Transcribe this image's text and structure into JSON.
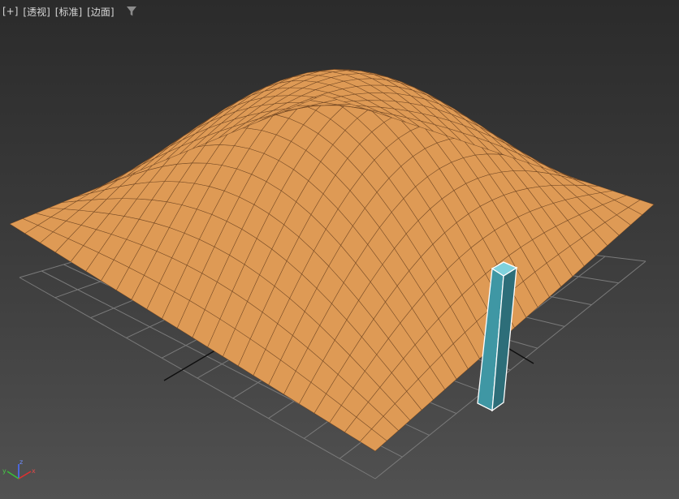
{
  "viewport": {
    "labels": {
      "menu": "[+]",
      "view": "[透视]",
      "shading": "[标准]",
      "style": "[边面]"
    },
    "filter_icon": "filter-icon"
  },
  "scene": {
    "surface_color": "#de9a55",
    "surface_edge_color": "#6b4220",
    "box_color": "#4aa9b8",
    "grid_color": "#7a7a7a"
  },
  "axis_gizmo": {
    "x": "x",
    "y": "y",
    "z": "z"
  }
}
